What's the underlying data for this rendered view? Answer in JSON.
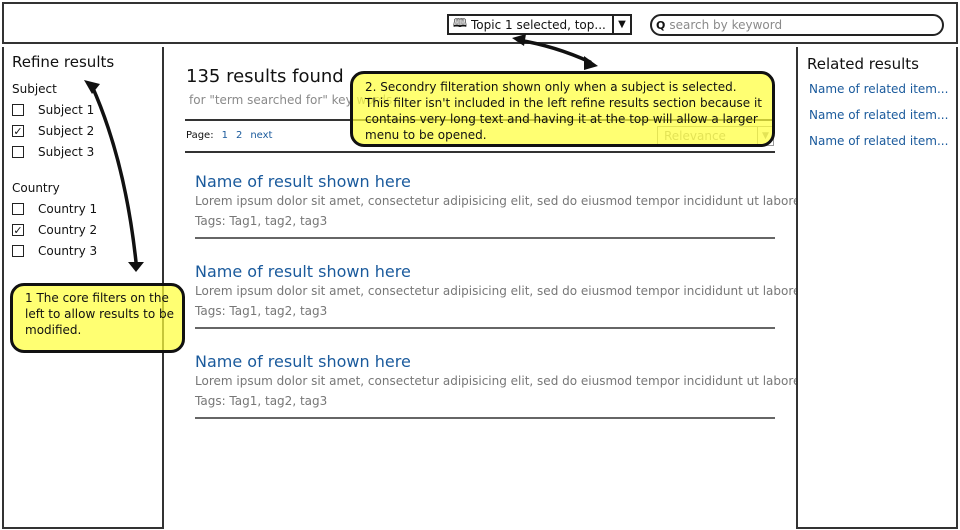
{
  "header": {
    "topic_select": {
      "icon": "book-icon",
      "value": "Topic 1 selected, top...",
      "arrow": "▼"
    },
    "search": {
      "placeholder": "search by keyword",
      "value": ""
    }
  },
  "sidebar": {
    "title": "Refine results",
    "groups": [
      {
        "label": "Subject",
        "items": [
          {
            "label": "Subject 1",
            "checked": false
          },
          {
            "label": "Subject 2",
            "checked": true
          },
          {
            "label": "Subject 3",
            "checked": false
          }
        ]
      },
      {
        "label": "Country",
        "items": [
          {
            "label": "Country 1",
            "checked": false
          },
          {
            "label": "Country 2",
            "checked": true
          },
          {
            "label": "Country 3",
            "checked": false
          }
        ]
      }
    ]
  },
  "main": {
    "title": "135 results found",
    "subtitle": "for \"term searched for\" key words",
    "pager": {
      "label": "Page:",
      "pages": [
        "1",
        "2"
      ],
      "next": "next"
    },
    "sort": {
      "value": "Relevance",
      "arrow": "▼"
    },
    "results": [
      {
        "name": "Name of result shown here",
        "desc": "Lorem ipsum dolor sit amet, consectetur adipisicing elit, sed do eiusmod tempor incididunt ut labore et",
        "tags": "Tags: Tag1, tag2, tag3"
      },
      {
        "name": "Name of result shown here",
        "desc": "Lorem ipsum dolor sit amet, consectetur adipisicing elit, sed do eiusmod tempor incididunt ut labore et",
        "tags": "Tags: Tag1, tag2, tag3"
      },
      {
        "name": "Name of result shown here",
        "desc": "Lorem ipsum dolor sit amet, consectetur adipisicing elit, sed do eiusmod tempor incididunt ut labore et",
        "tags": "Tags: Tag1, tag2, tag3"
      }
    ]
  },
  "related": {
    "title": "Related results",
    "items": [
      "Name of related item...",
      "Name of related item...",
      "Name of related item..."
    ]
  },
  "notes": {
    "note1": "1 The core filters on the left to allow results to be modified.",
    "note2": "2. Secondry filteration shown only when a subject is selected. This filter isn't included in the left refine results section because it contains very long text and having it at the top will allow a larger menu to be opened."
  },
  "colors": {
    "link": "#1a5a9c",
    "note": "#ffff3c",
    "muted": "#8a8a8a"
  }
}
